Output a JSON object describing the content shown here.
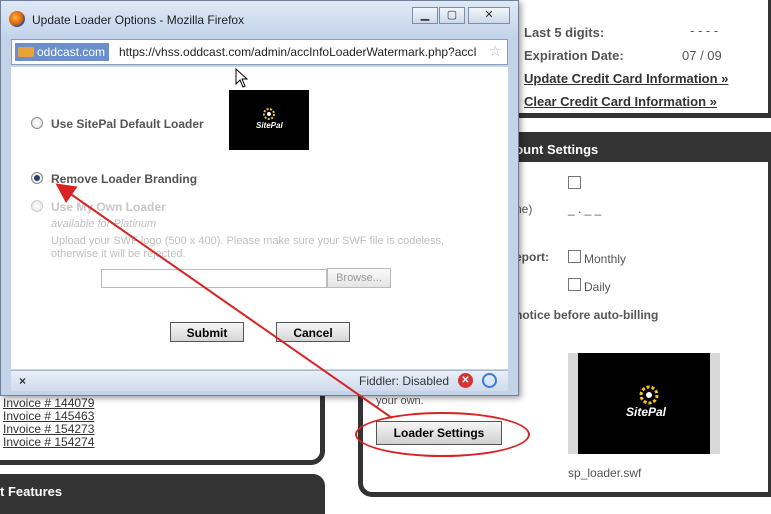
{
  "popup": {
    "title": "Update Loader Options - Mozilla Firefox",
    "site_badge": "oddcast.com",
    "url": "https://vhss.oddcast.com/admin/accInfoLoaderWatermark.php?accI",
    "options": {
      "default_label": "Use SitePal Default Loader",
      "remove_label": "Remove Loader Branding",
      "own_label": "Use My Own Loader",
      "own_note": "available for Platinum",
      "own_description": "Upload your SWF logo (500 x 400). Please make sure your SWF file is codeless, otherwise it will be rejected.",
      "browse_label": "Browse..."
    },
    "selected_option": "remove",
    "submit_label": "Submit",
    "cancel_label": "Cancel",
    "status": {
      "close_symbol": "×",
      "fiddler": "Fiddler: Disabled"
    },
    "logo_text": "SitePal"
  },
  "background": {
    "last5_label": "Last 5 digits:",
    "last5_value": "- - - -",
    "expiration_label": "Expiration Date:",
    "expiration_value": "07 / 09",
    "update_cc_link": "Update Credit Card Information »",
    "clear_cc_link": "Clear Credit Card Information »",
    "account_settings_header": "count Settings",
    "ne_fragment": "ne)",
    "ne_value": "_ . _ _",
    "report_label": "eport:",
    "monthly_label": "Monthly",
    "daily_label": "Daily",
    "notice_label": "notice before auto-billing",
    "your_own_text": "your own.",
    "loader_settings_button": "Loader Settings",
    "preview_filename": "sp_loader.swf",
    "preview_logo": "SitePal",
    "invoices": [
      "Invoice # 144079",
      "Invoice # 145463",
      "Invoice # 154273",
      "Invoice # 154274"
    ],
    "features_header": "t Features"
  },
  "colors": {
    "annotation_red": "#d92323",
    "panel_dark": "#333333"
  }
}
